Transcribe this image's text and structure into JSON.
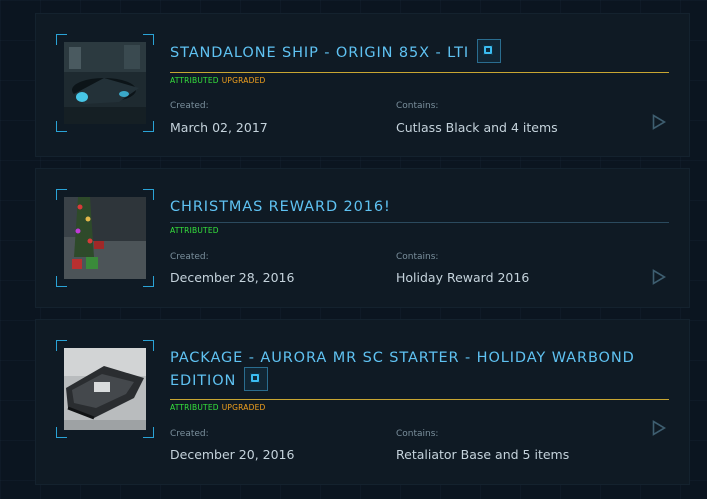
{
  "labels": {
    "created": "Created:",
    "contains": "Contains:"
  },
  "tags": {
    "attributed": "ATTRIBUTED",
    "upgraded": "UPGRADED"
  },
  "colors": {
    "title": "#5fc2f2",
    "separator_upgraded": "#c8a632",
    "separator_default": "#2b4a5e",
    "attributed": "#35e23c",
    "upgraded": "#f0a01e"
  },
  "pledges": [
    {
      "title_line1": "STANDALONE SHIP - ORIGIN 85X - LTI",
      "title_line2": "",
      "has_chip": true,
      "upgraded": true,
      "created": "March 02, 2017",
      "contains": "Cutlass Black and 4 items",
      "thumb_icon": "ship-thumbnail-icon"
    },
    {
      "title_line1": "CHRISTMAS REWARD 2016!",
      "title_line2": "",
      "has_chip": false,
      "upgraded": false,
      "created": "December 28, 2016",
      "contains": "Holiday Reward 2016",
      "thumb_icon": "christmas-tree-thumbnail-icon"
    },
    {
      "title_line1": "PACKAGE - AURORA MR SC STARTER - HOLIDAY WARBOND",
      "title_line2": "EDITION",
      "has_chip": true,
      "upgraded": true,
      "created": "December 20, 2016",
      "contains": "Retaliator Base and 5 items",
      "thumb_icon": "aurora-ship-thumbnail-icon"
    }
  ]
}
